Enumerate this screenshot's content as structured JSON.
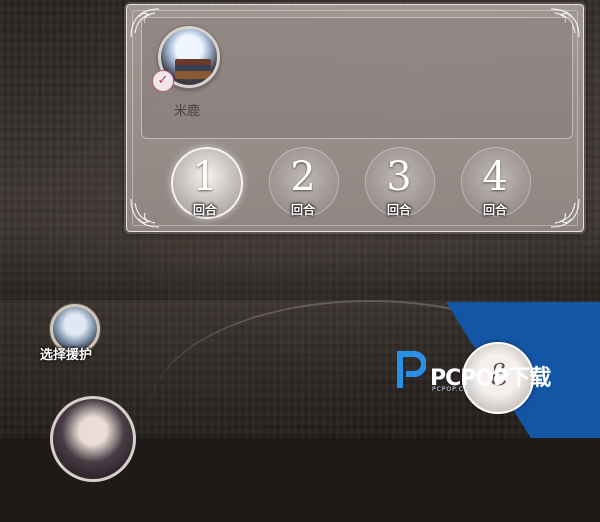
{
  "character": {
    "name": "米鹿",
    "icon": "moon-books-portrait",
    "badge_icon": "check-icon"
  },
  "rounds": [
    {
      "number": "1",
      "label": "回合",
      "active": true
    },
    {
      "number": "2",
      "label": "回合",
      "active": false
    },
    {
      "number": "3",
      "label": "回合",
      "active": false
    },
    {
      "number": "4",
      "label": "回合",
      "active": false
    }
  ],
  "support": {
    "label": "选择援护",
    "icon": "moon-books-portrait"
  },
  "skill": {
    "icon": "skill-rune-icon"
  },
  "watermark": {
    "text": "PCPOP下载",
    "sub": "PCPOP.COM"
  },
  "colors": {
    "panel_bg": "#a89f9b",
    "watermark_blue": "#1456a6",
    "accent_pink": "#b03a64"
  }
}
